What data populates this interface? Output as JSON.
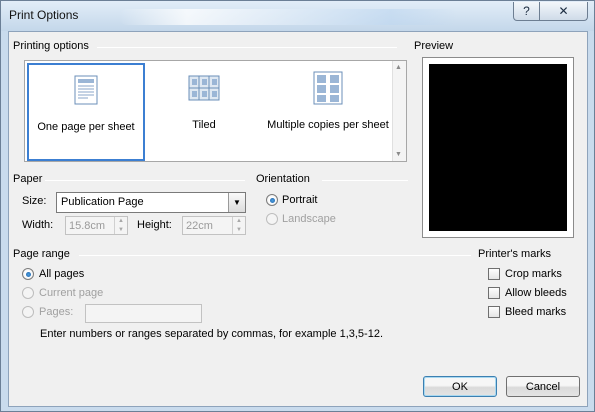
{
  "window": {
    "title": "Print Options",
    "help_label": "?",
    "close_label": "✕"
  },
  "printing_options": {
    "header": "Printing options",
    "items": [
      {
        "label": "One page per sheet",
        "icon": "single-page-icon",
        "selected": true
      },
      {
        "label": "Tiled",
        "icon": "tiled-pages-icon",
        "selected": false
      },
      {
        "label": "Multiple copies per sheet",
        "icon": "multiple-copies-icon",
        "selected": false
      }
    ]
  },
  "preview": {
    "header": "Preview"
  },
  "paper": {
    "header": "Paper",
    "size_label": "Size:",
    "size_value": "Publication Page",
    "width_label": "Width:",
    "width_value": "15.8cm",
    "height_label": "Height:",
    "height_value": "22cm"
  },
  "orientation": {
    "header": "Orientation",
    "portrait": "Portrait",
    "landscape": "Landscape",
    "selected": "Portrait"
  },
  "page_range": {
    "header": "Page range",
    "all_pages": "All pages",
    "current_page": "Current page",
    "pages": "Pages:",
    "pages_value": "",
    "hint": "Enter numbers or ranges separated by commas, for example 1,3,5-12.",
    "selected": "All pages"
  },
  "printers_marks": {
    "header": "Printer's marks",
    "crop_marks": "Crop marks",
    "allow_bleeds": "Allow bleeds",
    "bleed_marks": "Bleed marks"
  },
  "buttons": {
    "ok": "OK",
    "cancel": "Cancel"
  },
  "colors": {
    "selection_border": "#3c7fd2",
    "preview_page": "#000000",
    "window_frame": "#c9dbed"
  }
}
